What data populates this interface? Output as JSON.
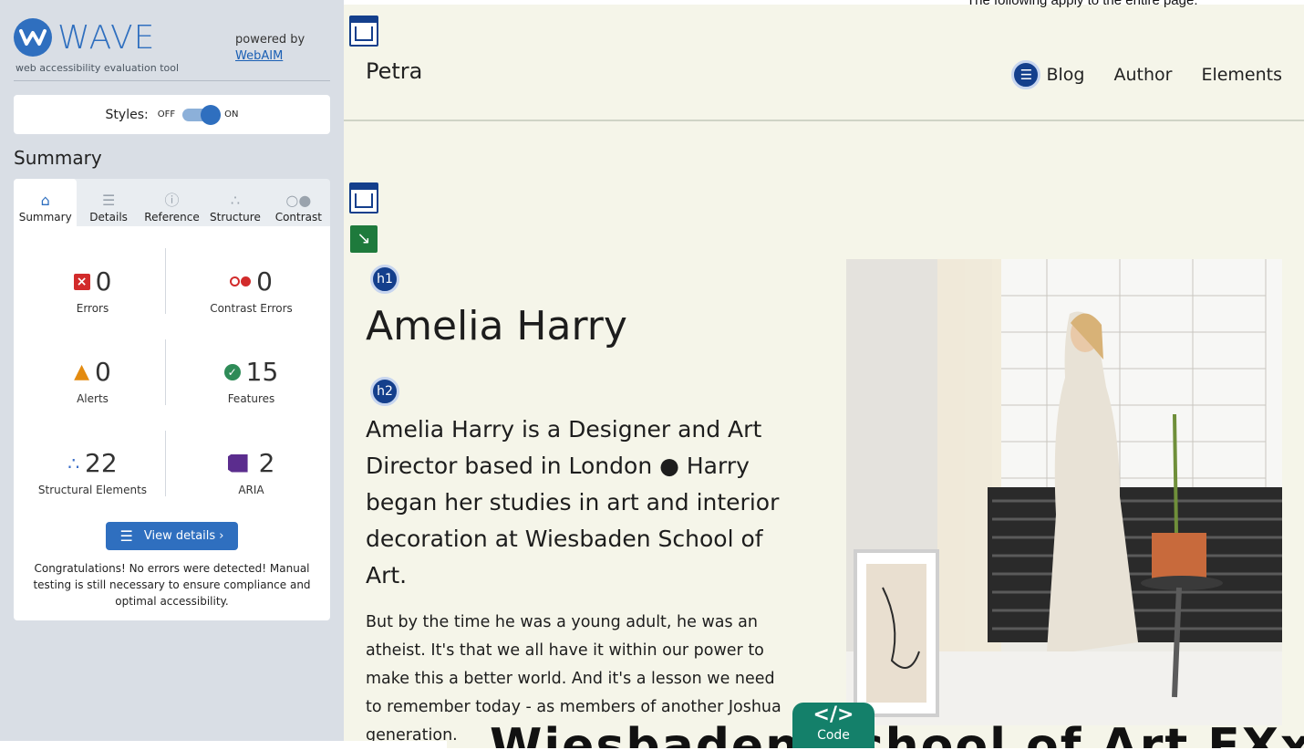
{
  "wave": {
    "logo_text": "WAVE",
    "tagline": "web accessibility evaluation tool",
    "powered_by": "powered by",
    "webaim_link": "WebAIM",
    "styles_label": "Styles:",
    "toggle_off": "OFF",
    "toggle_on": "ON",
    "summary_heading": "Summary",
    "tabs": [
      {
        "label": "Summary",
        "icon": "home-icon",
        "active": true
      },
      {
        "label": "Details",
        "icon": "list-icon",
        "active": false
      },
      {
        "label": "Reference",
        "icon": "info-icon",
        "active": false
      },
      {
        "label": "Structure",
        "icon": "hierarchy-icon",
        "active": false
      },
      {
        "label": "Contrast",
        "icon": "contrast-icon",
        "active": false
      }
    ],
    "stats": {
      "errors": {
        "value": "0",
        "label": "Errors"
      },
      "contrast_errors": {
        "value": "0",
        "label": "Contrast Errors"
      },
      "alerts": {
        "value": "0",
        "label": "Alerts"
      },
      "features": {
        "value": "15",
        "label": "Features"
      },
      "structural": {
        "value": "22",
        "label": "Structural Elements"
      },
      "aria": {
        "value": "2",
        "label": "ARIA"
      }
    },
    "view_details_label": "View details ›",
    "congrats": "Congratulations! No errors were detected! Manual testing is still necessary to ensure compliance and optimal accessibility.",
    "colors": {
      "accent": "#2f6fbf",
      "error": "#d22b2b",
      "alert": "#e38b10",
      "feature": "#2e8b57",
      "aria": "#5b2d8e"
    }
  },
  "page": {
    "top_note": "The following apply to the entire page:",
    "brand": "Petra",
    "nav": {
      "items": [
        "Blog",
        "Author",
        "Elements"
      ]
    },
    "badges": {
      "h1": "h1",
      "h2": "h2"
    },
    "hero_title": "Amelia Harry",
    "hero_intro": "Amelia Harry is a Designer and Art Director based in London ● Harry began her studies in art and interior decoration at Wiesbaden School of Art.",
    "hero_body": "But by the time he was a young adult, he was an atheist. It's that we all have it within our power to make this a better world. And it's a lesson we need to remember today - as members of another Joshua generation.",
    "bottom_cutoff": "Wiesbaden School of Art EXx",
    "code_button": {
      "glyph": "</>",
      "label": "Code"
    },
    "colors": {
      "background": "#f5f5e9",
      "wave_icon": "#143f8c",
      "code_button": "#14806a"
    }
  }
}
